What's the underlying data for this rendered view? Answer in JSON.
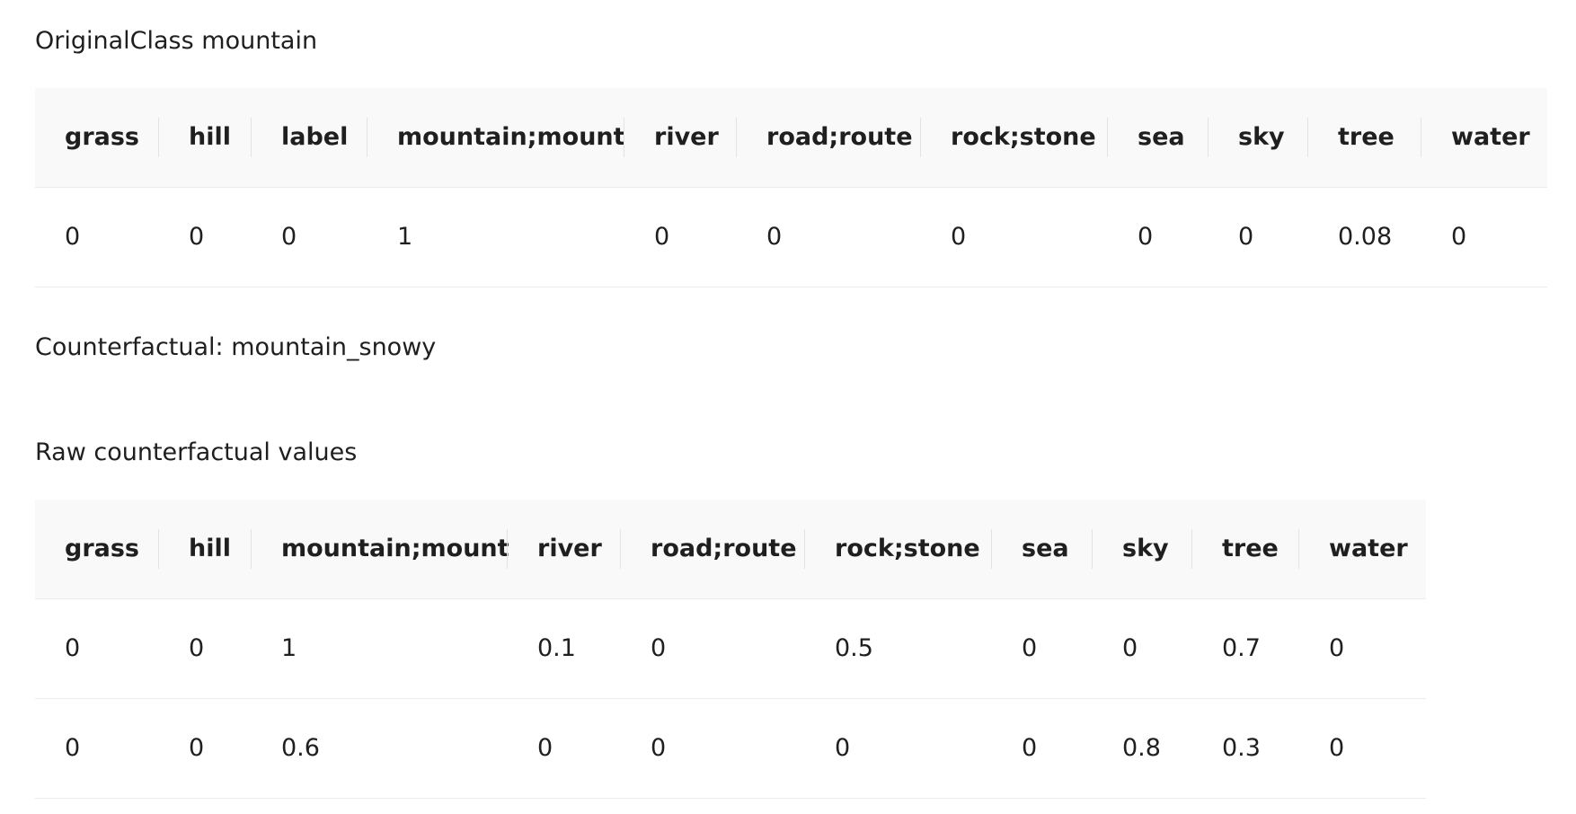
{
  "original_class": {
    "title": "OriginalClass mountain",
    "columns": [
      "grass",
      "hill",
      "label",
      "mountain;mount",
      "river",
      "road;route",
      "rock;stone",
      "sea",
      "sky",
      "tree",
      "water"
    ],
    "rows": [
      [
        "0",
        "0",
        "0",
        "1",
        "0",
        "0",
        "0",
        "0",
        "0",
        "0.08",
        "0"
      ]
    ]
  },
  "counterfactual": {
    "title": "Counterfactual: mountain_snowy"
  },
  "raw_values": {
    "title": "Raw counterfactual values",
    "columns": [
      "grass",
      "hill",
      "mountain;mount",
      "river",
      "road;route",
      "rock;stone",
      "sea",
      "sky",
      "tree",
      "water"
    ],
    "rows": [
      [
        "0",
        "0",
        "1",
        "0.1",
        "0",
        "0.5",
        "0",
        "0",
        "0.7",
        "0"
      ],
      [
        "0",
        "0",
        "0.6",
        "0",
        "0",
        "0",
        "0",
        "0.8",
        "0.3",
        "0"
      ]
    ]
  }
}
